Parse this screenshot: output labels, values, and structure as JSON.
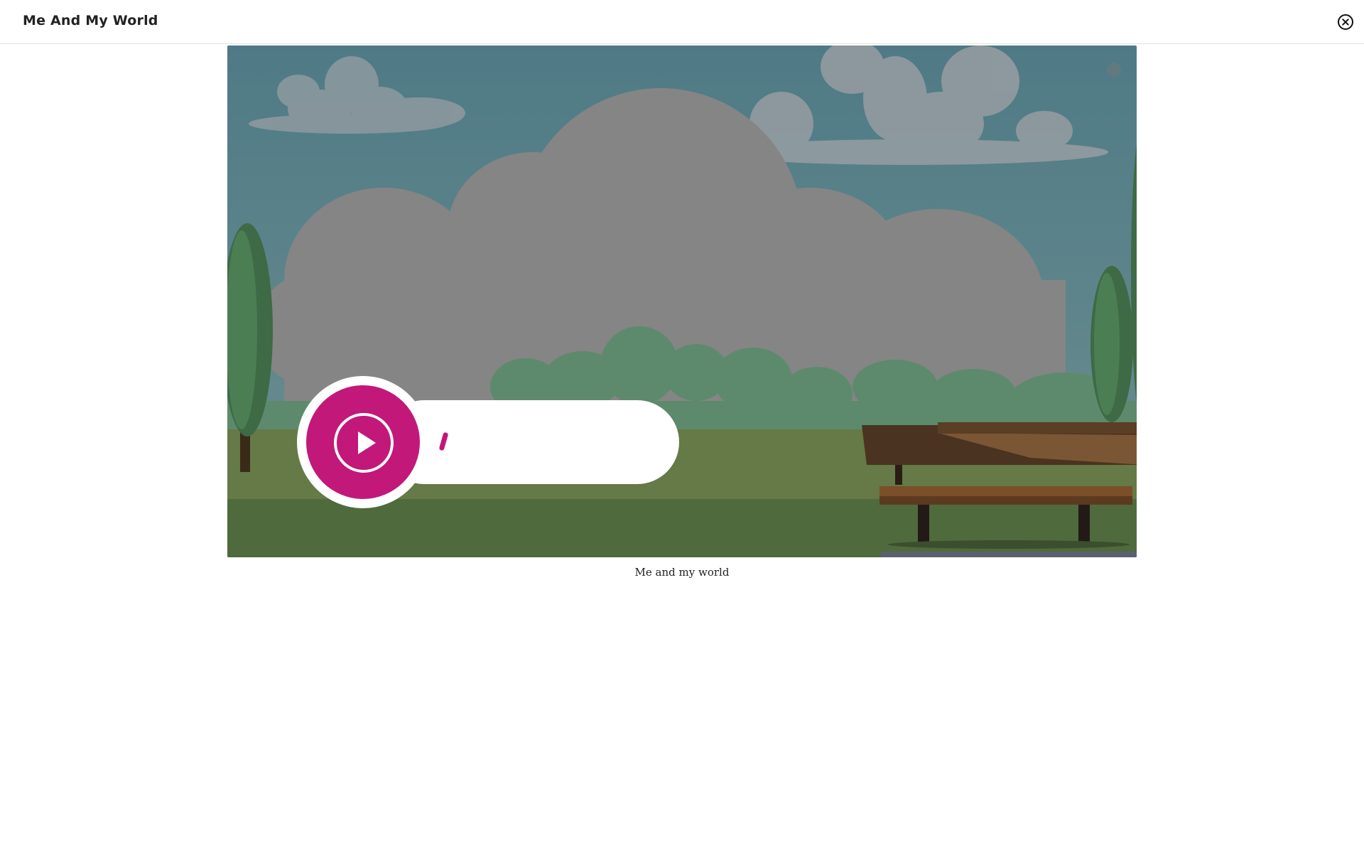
{
  "header": {
    "title": "Me And My World",
    "close_icon": "close-circle-icon"
  },
  "video": {
    "caption": "Me and my world",
    "play_icon": "play-icon",
    "accent_color": "#c2187a"
  }
}
